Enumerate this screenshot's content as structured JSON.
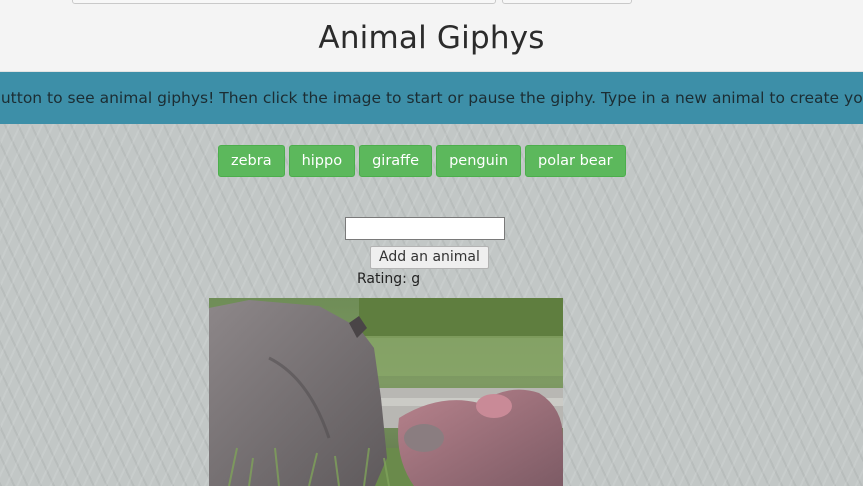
{
  "header": {
    "title": "Animal Giphys"
  },
  "banner": {
    "text": "button to see animal giphys! Then click the image to start or pause the giphy. Type in a new animal to create your own b"
  },
  "animal_buttons": [
    {
      "label": "zebra"
    },
    {
      "label": "hippo"
    },
    {
      "label": "giraffe"
    },
    {
      "label": "penguin"
    },
    {
      "label": "polar bear"
    }
  ],
  "form": {
    "input_value": "",
    "add_label": "Add an animal"
  },
  "results": [
    {
      "rating": "Rating: g",
      "image_subject": "rhino-and-hippo-gif"
    }
  ],
  "colors": {
    "banner": "#3d8fa8",
    "button_green": "#5cb85c",
    "header_bg": "#f4f4f4"
  }
}
